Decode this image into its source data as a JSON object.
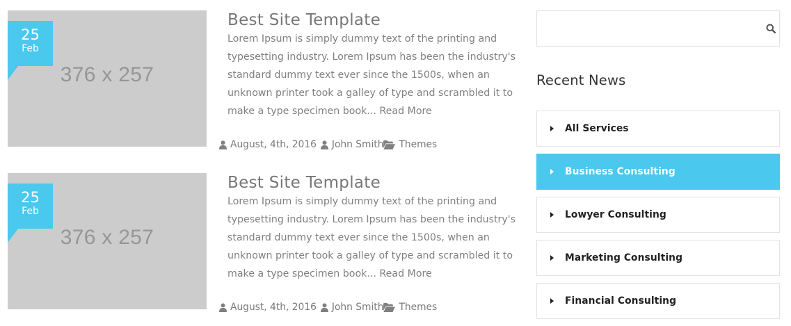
{
  "posts": [
    {
      "thumb_label": "376 x 257",
      "day": "25",
      "month": "Feb",
      "title": "Best Site Template",
      "excerpt": "Lorem Ipsum is simply dummy text of the printing and typesetting industry. Lorem Ipsum has been the industry's standard dummy text ever since the 1500s, when an unknown printer took a galley of type and scrambled it to make a type specimen book...",
      "read_more": "Read More",
      "date": "August, 4th, 2016",
      "author": "John Smith",
      "category": "Themes"
    },
    {
      "thumb_label": "376 x 257",
      "day": "25",
      "month": "Feb",
      "title": "Best Site Template",
      "excerpt": "Lorem Ipsum is simply dummy text of the printing and typesetting industry. Lorem Ipsum has been the industry's standard dummy text ever since the 1500s, when an unknown printer took a galley of type and scrambled it to make a type specimen book...",
      "read_more": "Read More",
      "date": "August, 4th, 2016",
      "author": "John Smith",
      "category": "Themes"
    }
  ],
  "sidebar": {
    "search": {
      "value": "",
      "placeholder": "",
      "icon": "search-icon"
    },
    "recent_news_title": "Recent News",
    "categories": [
      {
        "label": "All Services",
        "active": false
      },
      {
        "label": "Business Consulting",
        "active": true
      },
      {
        "label": "Lowyer Consulting",
        "active": false
      },
      {
        "label": "Marketing Consulting",
        "active": false
      },
      {
        "label": "Financial Consulting",
        "active": false
      }
    ]
  },
  "colors": {
    "accent": "#4ac8ee",
    "text": "#777777",
    "placeholder_bg": "#cccccc"
  }
}
